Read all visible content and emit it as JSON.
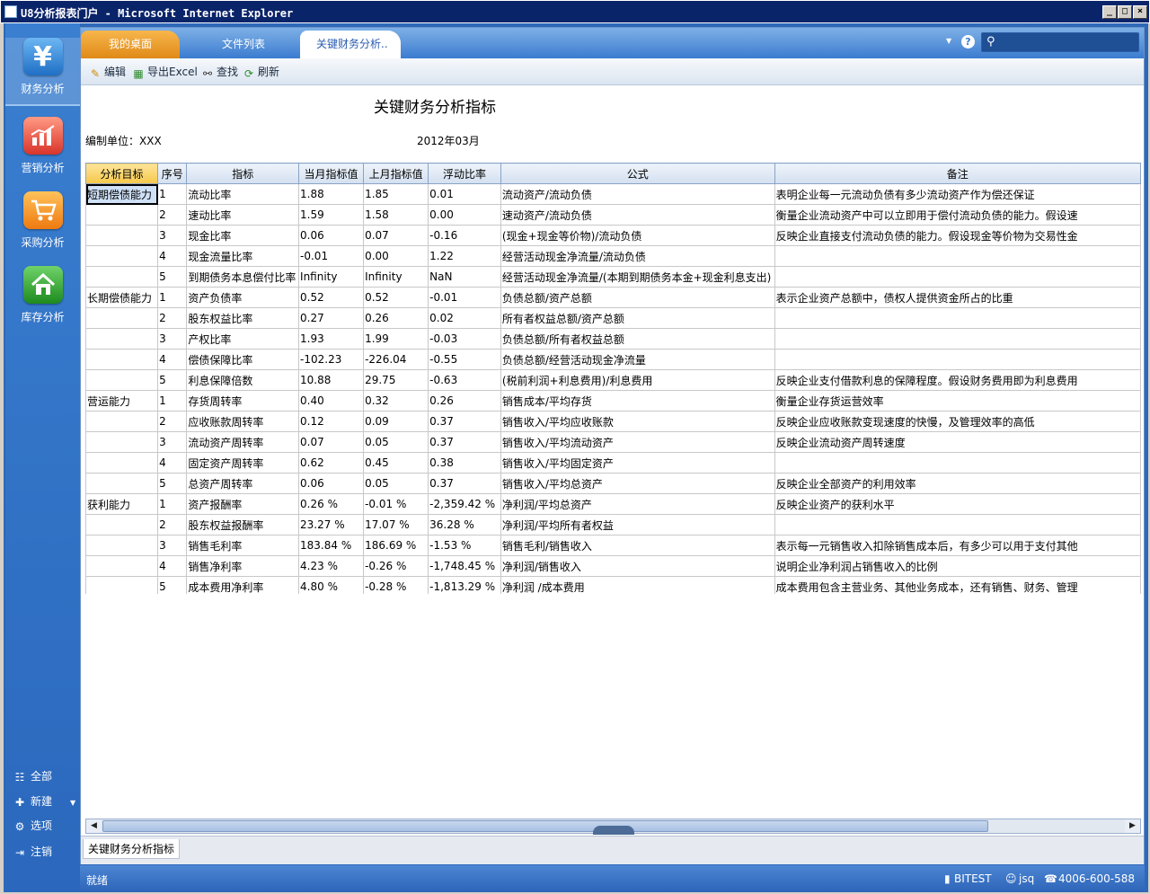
{
  "window": {
    "title": "U8分析报表门户 - Microsoft Internet Explorer",
    "min": "_",
    "max": "□",
    "close": "×"
  },
  "sidebar": {
    "items": [
      {
        "label": "财务分析",
        "icon": "yen-icon",
        "glyph": "¥",
        "color": "#2f86d6"
      },
      {
        "label": "营销分析",
        "icon": "chart-icon",
        "glyph": "📈",
        "color": "#e34a3a"
      },
      {
        "label": "采购分析",
        "icon": "cart-icon",
        "glyph": "🛒",
        "color": "#f28a1a"
      },
      {
        "label": "库存分析",
        "icon": "house-icon",
        "glyph": "⌂",
        "color": "#2e9a2e"
      }
    ],
    "bottom": [
      {
        "label": "全部",
        "icon": "tree-icon",
        "glyph": "☷"
      },
      {
        "label": "新建",
        "icon": "new-doc-icon",
        "glyph": "✚"
      },
      {
        "label": "选项",
        "icon": "gear-icon",
        "glyph": "⚙"
      },
      {
        "label": "注销",
        "icon": "logout-icon",
        "glyph": "⇥"
      }
    ]
  },
  "tabs": {
    "desk": "我的桌面",
    "files": "文件列表",
    "active": "关键财务分析.."
  },
  "toolbar": {
    "edit": "编辑",
    "export": "导出Excel",
    "find": "查找",
    "refresh": "刷新"
  },
  "report": {
    "title": "关键财务分析指标",
    "unit": "编制单位：XXX",
    "period": "2012年03月",
    "headers": [
      "分析目标",
      "序号",
      "指标",
      "当月指标值",
      "上月指标值",
      "浮动比率",
      "公式",
      "备注"
    ],
    "rows": [
      [
        "短期偿债能力",
        "1",
        "流动比率",
        "1.88",
        "1.85",
        "0.01",
        "流动资产/流动负债",
        "表明企业每一元流动负债有多少流动资产作为偿还保证"
      ],
      [
        "",
        "2",
        "速动比率",
        "1.59",
        "1.58",
        "0.00",
        "速动资产/流动负债",
        "衡量企业流动资产中可以立即用于偿付流动负债的能力。假设速"
      ],
      [
        "",
        "3",
        "现金比率",
        "0.06",
        "0.07",
        "-0.16",
        "(现金+现金等价物)/流动负债",
        "反映企业直接支付流动负债的能力。假设现金等价物为交易性金"
      ],
      [
        "",
        "4",
        "现金流量比率",
        "-0.01",
        "0.00",
        "1.22",
        "经营活动现金净流量/流动负债",
        ""
      ],
      [
        "",
        "5",
        "到期债务本息偿付比率",
        "Infinity",
        "Infinity",
        "NaN",
        "经营活动现金净流量/(本期到期债务本金+现金利息支出)",
        ""
      ],
      [
        "长期偿债能力",
        "1",
        "资产负债率",
        "0.52",
        "0.52",
        "-0.01",
        "负债总额/资产总额",
        "表示企业资产总额中，债权人提供资金所占的比重"
      ],
      [
        "",
        "2",
        "股东权益比率",
        "0.27",
        "0.26",
        "0.02",
        "所有者权益总额/资产总额",
        ""
      ],
      [
        "",
        "3",
        "产权比率",
        "1.93",
        "1.99",
        "-0.03",
        "负债总额/所有者权益总额",
        ""
      ],
      [
        "",
        "4",
        "偿债保障比率",
        "-102.23",
        "-226.04",
        "-0.55",
        "负债总额/经营活动现金净流量",
        ""
      ],
      [
        "",
        "5",
        "利息保障倍数",
        "10.88",
        "29.75",
        "-0.63",
        "(税前利润+利息费用)/利息费用",
        "反映企业支付借款利息的保障程度。假设财务费用即为利息费用"
      ],
      [
        "营运能力",
        "1",
        "存货周转率",
        "0.40",
        "0.32",
        "0.26",
        "销售成本/平均存货",
        "衡量企业存货运营效率"
      ],
      [
        "",
        "2",
        "应收账款周转率",
        "0.12",
        "0.09",
        "0.37",
        "销售收入/平均应收账款",
        "反映企业应收账款变现速度的快慢，及管理效率的高低"
      ],
      [
        "",
        "3",
        "流动资产周转率",
        "0.07",
        "0.05",
        "0.37",
        "销售收入/平均流动资产",
        "反映企业流动资产周转速度"
      ],
      [
        "",
        "4",
        "固定资产周转率",
        "0.62",
        "0.45",
        "0.38",
        "销售收入/平均固定资产",
        ""
      ],
      [
        "",
        "5",
        "总资产周转率",
        "0.06",
        "0.05",
        "0.37",
        "销售收入/平均总资产",
        "反映企业全部资产的利用效率"
      ],
      [
        "获利能力",
        "1",
        "资产报酬率",
        "0.26 %",
        "-0.01 %",
        "-2,359.42 %",
        "净利润/平均总资产",
        "反映企业资产的获利水平"
      ],
      [
        "",
        "2",
        "股东权益报酬率",
        "23.27 %",
        "17.07 %",
        "36.28 %",
        "净利润/平均所有者权益",
        ""
      ],
      [
        "",
        "3",
        "销售毛利率",
        "183.84 %",
        "186.69 %",
        "-1.53 %",
        "销售毛利/销售收入",
        "表示每一元销售收入扣除销售成本后，有多少可以用于支付其他"
      ],
      [
        "",
        "4",
        "销售净利率",
        "4.23 %",
        "-0.26 %",
        "-1,748.45 %",
        "净利润/销售收入",
        "说明企业净利润占销售收入的比例"
      ],
      [
        "",
        "5",
        "成本费用净利率",
        "4.80 %",
        "-0.28 %",
        "-1,813.29 %",
        "净利润 /成本费用",
        "成本费用包含主营业务、其他业务成本，还有销售、财务、管理"
      ]
    ]
  },
  "sheet_tab": "关键财务分析指标",
  "status": {
    "left": "就绪",
    "server": "BITEST",
    "user": "jsq",
    "phone": "4006-600-588"
  }
}
